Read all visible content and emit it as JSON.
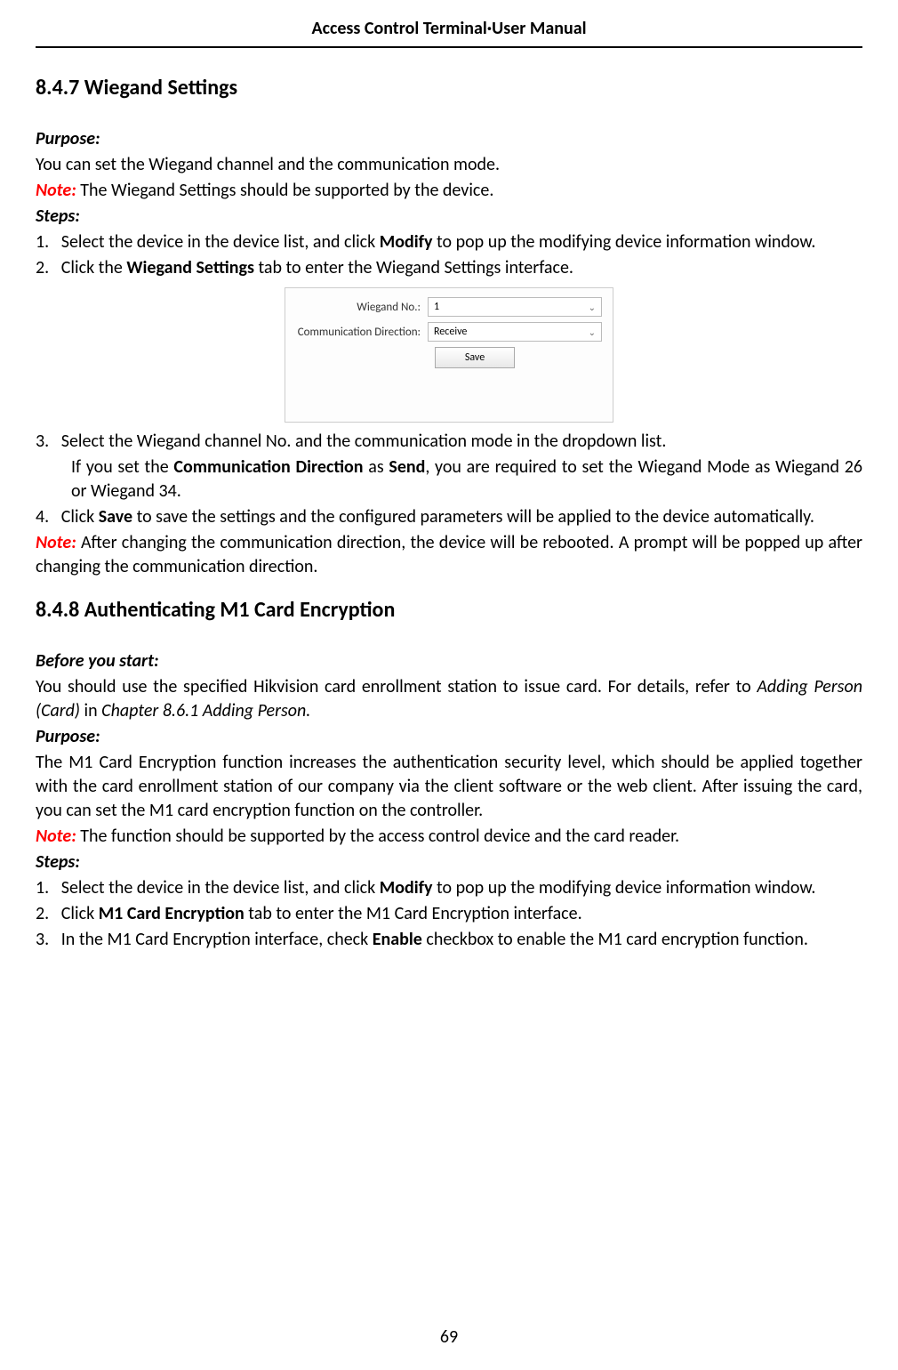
{
  "header": {
    "title": "Access Control Terminal·User Manual"
  },
  "section1": {
    "heading": "8.4.7   Wiegand Settings",
    "purpose_label": "Purpose:",
    "purpose_text": "You can set the Wiegand channel and the communication mode.",
    "note_label": "Note:",
    "note_text": " The Wiegand Settings should be supported by the device.",
    "steps_label": "Steps:",
    "step1_num": "1.",
    "step1_a": "Select the device in the device list, and click ",
    "step1_b": "Modify",
    "step1_c": " to pop up the modifying device information window.",
    "step2_num": "2.",
    "step2_a": "Click the ",
    "step2_b": "Wiegand Settings",
    "step2_c": " tab to enter the Wiegand Settings interface.",
    "step3_num": "3.",
    "step3_a": "Select the Wiegand channel No. and the communication mode in the dropdown list.",
    "step3_sub_a": "If you set the ",
    "step3_sub_b": "Communication Direction",
    "step3_sub_c": " as ",
    "step3_sub_d": "Send",
    "step3_sub_e": ", you are required to set the Wiegand Mode as Wiegand 26 or Wiegand 34.",
    "step4_num": "4.",
    "step4_a": "Click ",
    "step4_b": "Save",
    "step4_c": " to save the settings and the configured parameters will be applied to the device automatically.",
    "note2_label": "Note:",
    "note2_text": " After changing the communication direction, the device will be rebooted. A prompt will be popped up after changing the communication direction."
  },
  "screenshot": {
    "wiegand_label": "Wiegand No.:",
    "wiegand_value": "1",
    "comm_label": "Communication Direction:",
    "comm_value": "Receive",
    "save_label": "Save"
  },
  "section2": {
    "heading": "8.4.8   Authenticating M1 Card Encryption",
    "before_label": "Before you start:",
    "before_a": "You should use the specified Hikvision card enrollment station to issue card. For details, refer to ",
    "before_b": "Adding Person (Card)",
    "before_c": " in ",
    "before_d": "Chapter 8.6.1 Adding Person.",
    "purpose_label": "Purpose:",
    "purpose_text": "The M1 Card Encryption function increases the authentication security level, which should be applied together with the card enrollment station of our company via the client software or the web client. After issuing the card, you can set the M1 card encryption function on the controller.",
    "note_label": "Note:",
    "note_text": " The function should be supported by the access control device and the card reader.",
    "steps_label": "Steps:",
    "step1_num": "1.",
    "step1_a": "Select the device in the device list, and click ",
    "step1_b": "Modify",
    "step1_c": " to pop up the modifying device information window.",
    "step2_num": "2.",
    "step2_a": "Click ",
    "step2_b": "M1 Card Encryption",
    "step2_c": " tab to enter the M1 Card Encryption interface.",
    "step3_num": "3.",
    "step3_a": "In the M1 Card Encryption interface, check ",
    "step3_b": "Enable",
    "step3_c": " checkbox to enable the M1 card encryption function."
  },
  "page_number": "69"
}
